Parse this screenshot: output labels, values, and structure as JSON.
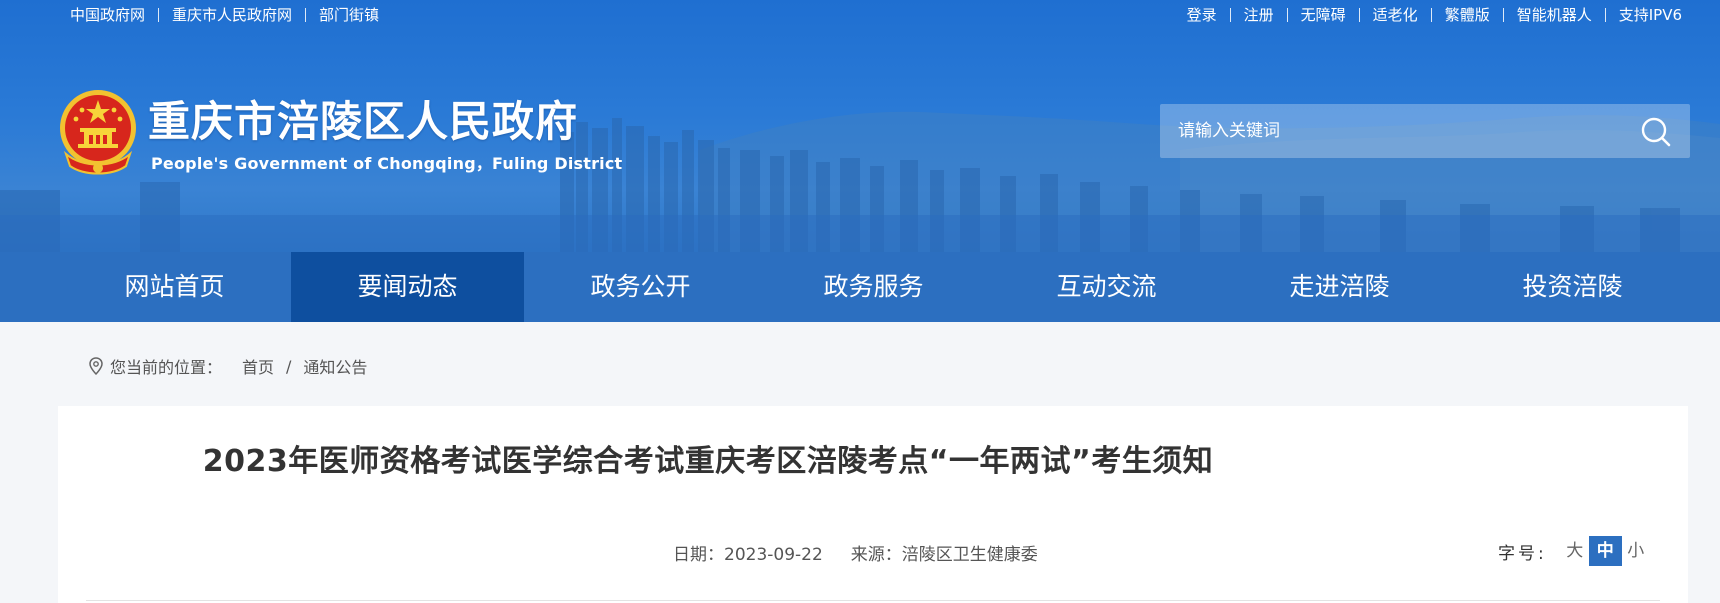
{
  "top_links_left": [
    "中国政府网",
    "重庆市人民政府网",
    "部门街镇"
  ],
  "top_links_right": [
    "登录",
    "注册",
    "无障碍",
    "适老化",
    "繁體版",
    "智能机器人",
    "支持IPV6"
  ],
  "header": {
    "title": "重庆市涪陵区人民政府",
    "subtitle": "People's Government of Chongqing，Fuling District"
  },
  "search": {
    "placeholder": "请输入关键词"
  },
  "nav": {
    "items": [
      "网站首页",
      "要闻动态",
      "政务公开",
      "政务服务",
      "互动交流",
      "走进涪陵",
      "投资涪陵"
    ],
    "active_index": 1
  },
  "breadcrumb": {
    "prefix": "您当前的位置：",
    "items": [
      "首页",
      "通知公告"
    ],
    "separator": "/"
  },
  "article": {
    "title": "2023年医师资格考试医学综合考试重庆考区涪陵考点“一年两试”考生须知",
    "date": "日期：2023-09-22",
    "source": "来源：涪陵区卫生健康委"
  },
  "font_size": {
    "label": "字号:",
    "options": [
      "大",
      "中",
      "小"
    ],
    "active": "中"
  },
  "colors": {
    "nav_bg": "#2c6fc0",
    "nav_active": "#0e4f9f",
    "banner": "#2a7ad6"
  }
}
